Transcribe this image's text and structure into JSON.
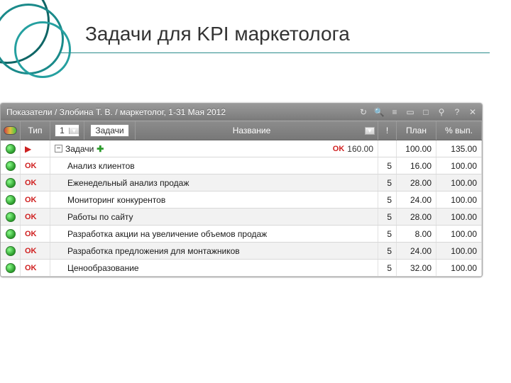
{
  "slide": {
    "title": "Задачи для KPI маркетолога"
  },
  "window": {
    "title": "Показатели / Злобина Т. В. / маркетолог, 1-31 Мая 2012",
    "toolbar_icons": [
      "refresh",
      "search",
      "filter",
      "collapse",
      "split",
      "pin",
      "help",
      "close"
    ]
  },
  "header": {
    "type_label": "Тип",
    "spinner_value": "1",
    "category_label": "Задачи",
    "name_label": "Название",
    "priority_label": "!",
    "plan_label": "План",
    "pct_label": "% вып."
  },
  "summary": {
    "label": "Задачи",
    "ok_text": "OK",
    "total": "160.00",
    "plan": "100.00",
    "pct": "135.00"
  },
  "rows": [
    {
      "status": "OK",
      "name": "Анализ клиентов",
      "priority": "5",
      "plan": "16.00",
      "pct": "100.00"
    },
    {
      "status": "OK",
      "name": "Еженедельный анализ продаж",
      "priority": "5",
      "plan": "28.00",
      "pct": "100.00"
    },
    {
      "status": "OK",
      "name": "Мониторинг конкурентов",
      "priority": "5",
      "plan": "24.00",
      "pct": "100.00"
    },
    {
      "status": "OK",
      "name": "Работы по сайту",
      "priority": "5",
      "plan": "28.00",
      "pct": "100.00"
    },
    {
      "status": "OK",
      "name": "Разработка акции на увеличение объемов продаж",
      "priority": "5",
      "plan": "8.00",
      "pct": "100.00"
    },
    {
      "status": "OK",
      "name": "Разработка предложения для монтажников",
      "priority": "5",
      "plan": "24.00",
      "pct": "100.00"
    },
    {
      "status": "OK",
      "name": "Ценообразование",
      "priority": "5",
      "plan": "32.00",
      "pct": "100.00"
    }
  ],
  "chart_data": {
    "type": "table",
    "title": "Задачи для KPI маркетолога",
    "columns": [
      "Название",
      "!",
      "План",
      "% вып."
    ],
    "rows": [
      [
        "Анализ клиентов",
        5,
        16.0,
        100.0
      ],
      [
        "Еженедельный анализ продаж",
        5,
        28.0,
        100.0
      ],
      [
        "Мониторинг конкурентов",
        5,
        24.0,
        100.0
      ],
      [
        "Работы по сайту",
        5,
        28.0,
        100.0
      ],
      [
        "Разработка акции на увеличение объемов продаж",
        5,
        8.0,
        100.0
      ],
      [
        "Разработка предложения для монтажников",
        5,
        24.0,
        100.0
      ],
      [
        "Ценообразование",
        5,
        32.0,
        100.0
      ]
    ],
    "totals": {
      "План": 160.0,
      "% вып.": 135.0
    }
  }
}
